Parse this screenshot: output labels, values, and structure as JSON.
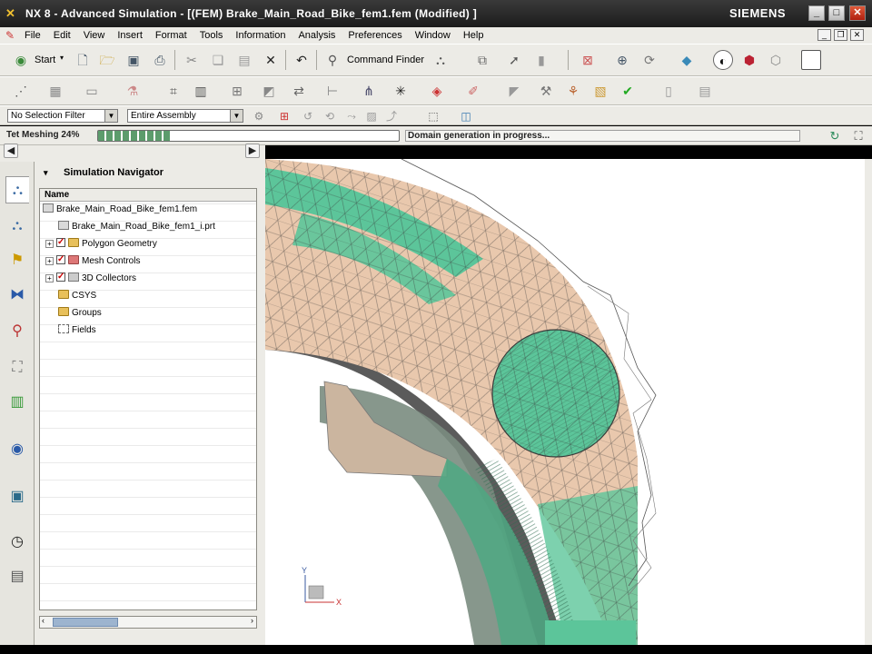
{
  "window": {
    "title": "NX 8 - Advanced Simulation - [(FEM) Brake_Main_Road_Bike_fem1.fem (Modified) ]",
    "brand": "SIEMENS",
    "controls": {
      "minimize": "_",
      "maximize": "□",
      "close": "✕"
    }
  },
  "menubar": {
    "items": [
      "File",
      "Edit",
      "View",
      "Insert",
      "Format",
      "Tools",
      "Information",
      "Analysis",
      "Preferences",
      "Window",
      "Help"
    ]
  },
  "toolbar": {
    "start_label": "Start",
    "command_finder_label": "Command Finder"
  },
  "selection_bar": {
    "filter_value": "No Selection Filter",
    "scope_value": "Entire Assembly"
  },
  "progress": {
    "label": "Tet Meshing 24%",
    "percent": 24,
    "status": "Domain generation in progress..."
  },
  "navigator": {
    "title": "Simulation Navigator",
    "column": "Name",
    "items": [
      {
        "label": "Brake_Main_Road_Bike_fem1.fem"
      },
      {
        "label": "Brake_Main_Road_Bike_fem1_i.prt"
      },
      {
        "label": "Polygon Geometry"
      },
      {
        "label": "Mesh Controls"
      },
      {
        "label": "3D Collectors"
      },
      {
        "label": "CSYS"
      },
      {
        "label": "Groups"
      },
      {
        "label": "Fields"
      }
    ]
  },
  "viewport": {
    "triad": {
      "y": "Y",
      "x": "X"
    },
    "colors": {
      "mesh_green": "#5cc59a",
      "mesh_tan": "#e9c8ad",
      "background": "#ffffff"
    }
  }
}
